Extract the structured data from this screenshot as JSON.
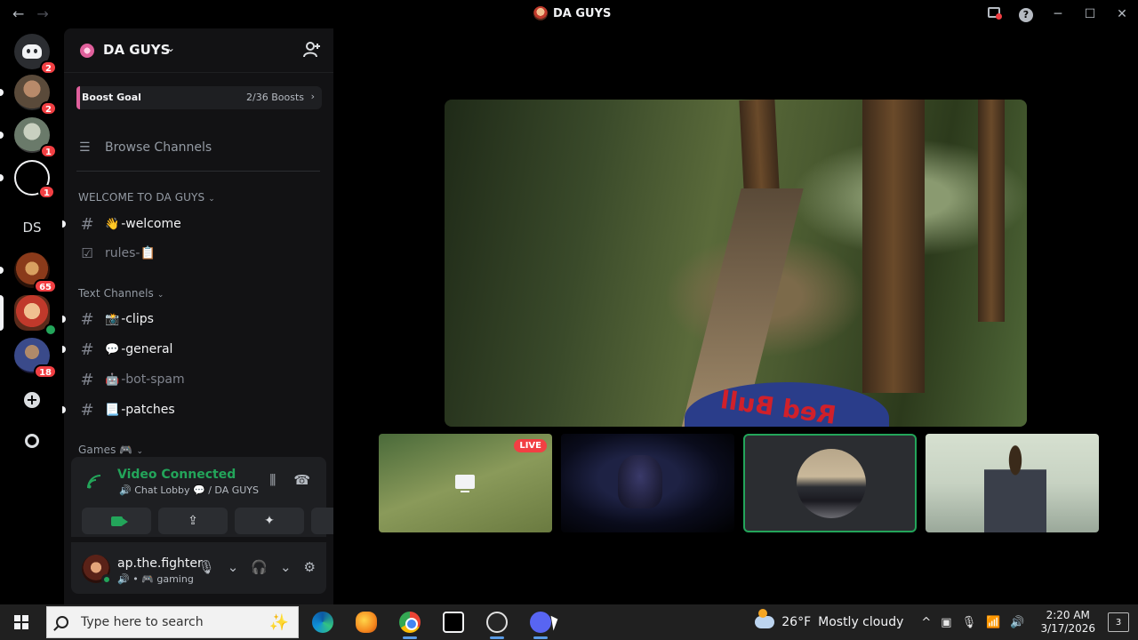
{
  "window": {
    "title": "DA GUYS",
    "back_glyph": "←",
    "forward_glyph": "→",
    "minimize_glyph": "─",
    "maximize_glyph": "☐",
    "close_glyph": "✕",
    "help_glyph": "?"
  },
  "guilds": [
    {
      "name": "home",
      "badge": "2"
    },
    {
      "name": "guild-1",
      "badge": "2"
    },
    {
      "name": "guild-2",
      "badge": "1"
    },
    {
      "name": "guild-3",
      "badge": "1"
    },
    {
      "name": "guild-ds",
      "label": "DS",
      "badge": ""
    },
    {
      "name": "guild-5",
      "badge": "65"
    },
    {
      "name": "guild-6",
      "badge": ""
    },
    {
      "name": "guild-7",
      "badge": "18"
    }
  ],
  "guild_add_glyph": "+",
  "server": {
    "name": "DA GUYS",
    "chevron": "⌄",
    "boost_label": "Boost Goal",
    "boost_count": "2/36 Boosts",
    "boost_arrow": "›",
    "browse_icon": "☰",
    "browse_label": "Browse Channels"
  },
  "categories": {
    "welcome": "WELCOME TO DA GUYS",
    "text": "Text Channels",
    "games": "Games 🎮"
  },
  "category_chevron": "⌄",
  "channels": [
    {
      "hash": "#",
      "emoji": "👋",
      "name": "-welcome"
    },
    {
      "hash": "☑",
      "emoji": "",
      "name": "rules-📋"
    },
    {
      "hash": "#",
      "emoji": "📸",
      "name": "-clips"
    },
    {
      "hash": "#",
      "emoji": "💬",
      "name": "-general"
    },
    {
      "hash": "#",
      "emoji": "🤖",
      "name": "-bot-spam"
    },
    {
      "hash": "#",
      "emoji": "📃",
      "name": "-patches"
    }
  ],
  "voice": {
    "status": "Video Connected",
    "channel": "🔊 Chat Lobby 💬 / DA GUYS",
    "soundboard_glyph": "⫼",
    "disconnect_glyph": "☎",
    "screen_share_glyph": "⇪",
    "activity_glyph": "✦",
    "soundboard2_glyph": "♪"
  },
  "user": {
    "name": "ap.the.fighter",
    "status": "🔊 • 🎮 gaming",
    "mic_glyph": "🎙",
    "headphone_glyph": "🎧",
    "settings_glyph": "⚙",
    "caret_glyph": "⌄"
  },
  "stage": {
    "main_caption": "Red Bull",
    "live_label": "LIVE"
  },
  "taskbar": {
    "search_placeholder": "Type here to search",
    "weather_temp": "26°F",
    "weather_desc": "Mostly cloudy",
    "weather_badge": "3",
    "time": "2:20 AM",
    "date": "3/17/2026",
    "notification_count": "3",
    "tray_up_glyph": "^",
    "spark_glyph": "✨"
  },
  "colors": {
    "accent_green": "#23a55a",
    "badge_red": "#f23f43",
    "blurple": "#5865f2"
  }
}
